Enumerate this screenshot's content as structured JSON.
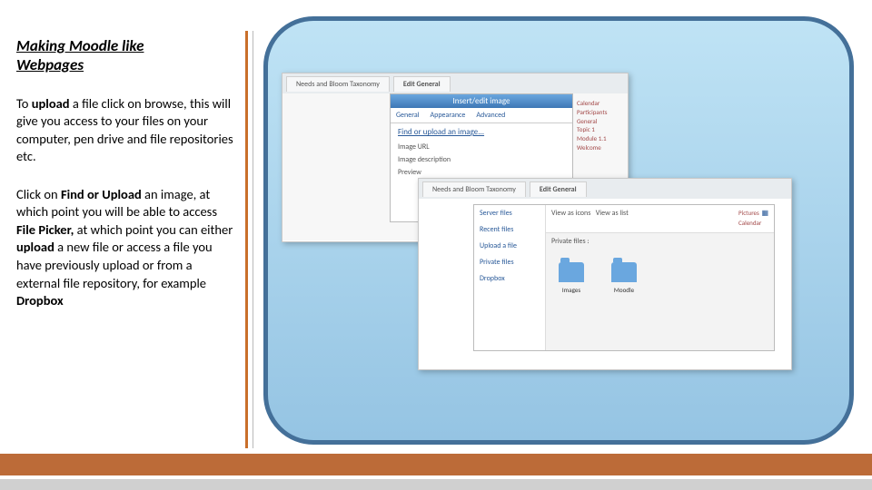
{
  "title_line1": "Making Moodle like",
  "title_line2": "Webpages",
  "para1": {
    "t1": "To ",
    "b1": "upload",
    "t2": " a file click on browse, this will give you access to your files on your computer, pen drive and file repositories etc."
  },
  "para2": {
    "t1": "Click on ",
    "b1": "Find or Upload",
    "t2": " an image, at which point you will be able to access ",
    "b2": "File Picker,",
    "t3": " at which point you can either ",
    "b3": "upload",
    "t4": " a new file or access a file you have previously upload or from a external file repository, for example ",
    "b4": "Dropbox"
  },
  "shot1": {
    "tab1": "Needs and Bloom Taxonomy",
    "tab2": "Edit General",
    "dlg_title": "Insert/edit image",
    "dlg_tab1": "General",
    "dlg_tab2": "Appearance",
    "dlg_tab3": "Advanced",
    "link": "Find or upload an image...",
    "lbl1": "Image URL",
    "lbl2": "Image description",
    "lbl3": "Preview",
    "side": [
      "Calendar",
      "Participants",
      "General",
      "Topic 1",
      "Module 1.1 Welcome"
    ]
  },
  "shot2": {
    "tab1": "Needs and Bloom Taxonomy",
    "tab2": "Edit General",
    "fp_top_left": "View as icons",
    "fp_top_right": "View as list",
    "fp_label": "Private files :",
    "nav": [
      "Server files",
      "Recent files",
      "Upload a file",
      "Private files",
      "Dropbox"
    ],
    "folders": [
      "Images",
      "Moodle"
    ],
    "side": [
      "Pictures",
      "Calendar"
    ]
  }
}
